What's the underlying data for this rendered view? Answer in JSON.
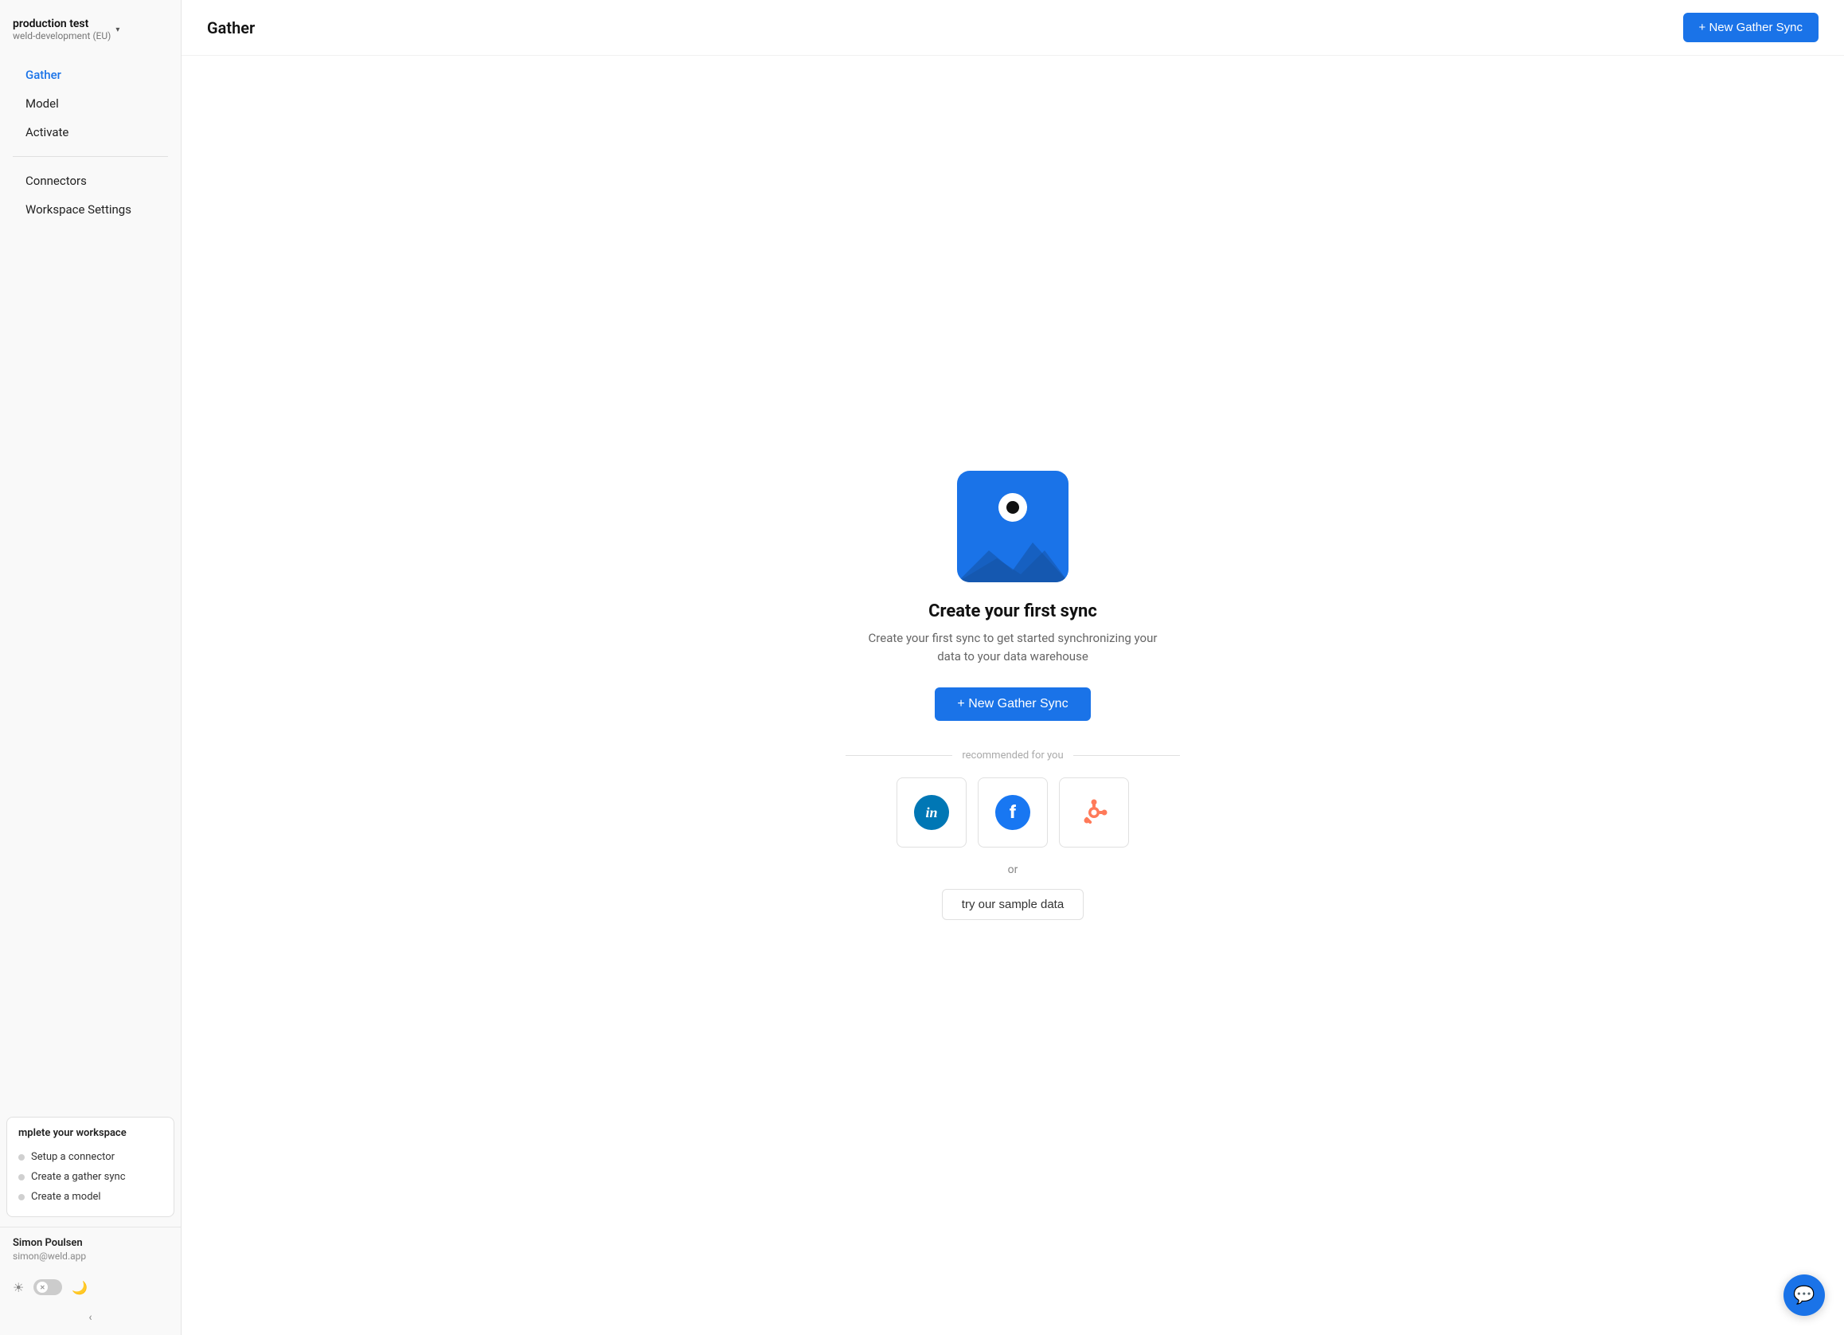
{
  "workspace": {
    "name": "production test",
    "sub": "weld-development (EU)",
    "chevron": "▾"
  },
  "sidebar": {
    "nav_items": [
      {
        "label": "Gather",
        "active": true
      },
      {
        "label": "Model",
        "active": false
      },
      {
        "label": "Activate",
        "active": false
      }
    ],
    "bottom_items": [
      {
        "label": "Connectors"
      },
      {
        "label": "Workspace Settings"
      }
    ],
    "complete_workspace": {
      "title": "mplete your workspace",
      "items": [
        {
          "label": "Setup a connector"
        },
        {
          "label": "Create a gather sync"
        },
        {
          "label": "Create a model"
        }
      ]
    },
    "user": {
      "name": "Simon Poulsen",
      "email": "simon@weld.app"
    },
    "collapse_label": "‹"
  },
  "topbar": {
    "title": "Gather",
    "new_sync_btn": "+ New Gather Sync"
  },
  "main": {
    "create_title": "Create your first sync",
    "create_desc": "Create your first sync to get started synchronizing your data to your data warehouse",
    "new_sync_center_btn": "+ New Gather Sync",
    "recommended_label": "recommended for you",
    "or_label": "or",
    "sample_data_btn": "try our sample data",
    "connectors": [
      {
        "name": "linkedin",
        "label": "in"
      },
      {
        "name": "facebook",
        "label": "f"
      },
      {
        "name": "hubspot",
        "label": "hs"
      }
    ]
  },
  "colors": {
    "primary": "#1a73e8",
    "sidebar_bg": "#f9f9f9",
    "active_nav": "#1a73e8"
  }
}
